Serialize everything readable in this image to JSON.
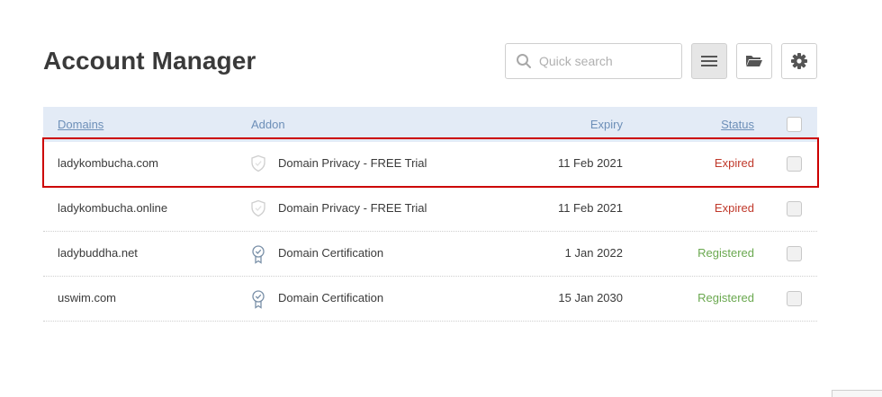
{
  "page": {
    "title": "Account Manager"
  },
  "search": {
    "placeholder": "Quick search"
  },
  "toolbar": {
    "list_icon": "list-icon",
    "folder_icon": "folder-icon",
    "gear_icon": "gear-icon"
  },
  "table": {
    "headers": {
      "domains": "Domains",
      "addon": "Addon",
      "expiry": "Expiry",
      "status": "Status"
    },
    "rows": [
      {
        "domain": "ladykombucha.com",
        "addon_icon": "shield-icon",
        "addon": "Domain Privacy - FREE Trial",
        "expiry": "11 Feb 2021",
        "status": "Expired"
      },
      {
        "domain": "ladykombucha.online",
        "addon_icon": "shield-icon",
        "addon": "Domain Privacy - FREE Trial",
        "expiry": "11 Feb 2021",
        "status": "Expired"
      },
      {
        "domain": "ladybuddha.net",
        "addon_icon": "certificate-icon",
        "addon": "Domain Certification",
        "expiry": "1 Jan 2022",
        "status": "Registered"
      },
      {
        "domain": "uswim.com",
        "addon_icon": "certificate-icon",
        "addon": "Domain Certification",
        "expiry": "15 Jan 2030",
        "status": "Registered"
      }
    ]
  },
  "colors": {
    "expired": "#c0392b",
    "registered": "#6aa84f",
    "header_bg": "#e3ebf6",
    "header_text": "#6d8fb8",
    "highlight": "#cc0000"
  }
}
